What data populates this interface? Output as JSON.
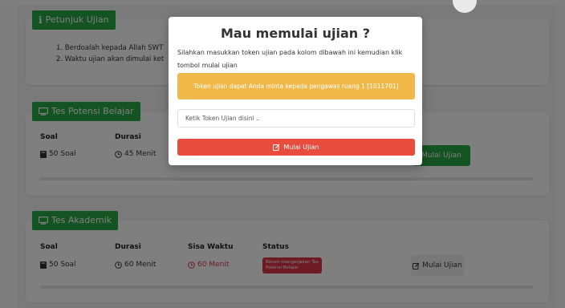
{
  "petunjuk": {
    "title": "Petunjuk Ujian",
    "items": [
      "1.  Berdoalah kepada Allah SWT",
      "2.  Waktu ujian akan dimulai ket"
    ]
  },
  "tests": [
    {
      "title": "Tes Potensi Belajar",
      "soal_label": "Soal",
      "soal_value": "50 Soal",
      "durasi_label": "Durasi",
      "durasi_value": "45 Menit",
      "button_label": "Mulai Ujian"
    },
    {
      "title": "Tes Akademik",
      "soal_label": "Soal",
      "soal_value": "50 Soal",
      "durasi_label": "Durasi",
      "durasi_value": "60 Menit",
      "sisa_label": "Sisa Waktu",
      "sisa_value": "60 Menit",
      "status_label": "Status",
      "status_badge": "Belum mengerjakan Tes Potensi Belajar",
      "button_label": "Mulai Ujian"
    }
  ],
  "modal": {
    "title": "Mau memulai ujian ?",
    "description": "Silahkan masukkan token ujian pada kolom dibawah ini kemudian klik tombol mulai ujian",
    "alert": "Token ujian dapat Anda minta kepada pengawas ruang 1 [1011701]",
    "input_placeholder": "Ketik Token Ujian disini ..",
    "input_value": "",
    "button_label": "Mulai Ujian"
  },
  "colors": {
    "green": "#28a745",
    "red": "#e74c3c",
    "warning": "#f0b849"
  },
  "icons": {
    "info": "info-icon",
    "monitor": "monitor-icon",
    "book": "book-icon",
    "clock": "clock-icon",
    "edit": "edit-icon"
  }
}
